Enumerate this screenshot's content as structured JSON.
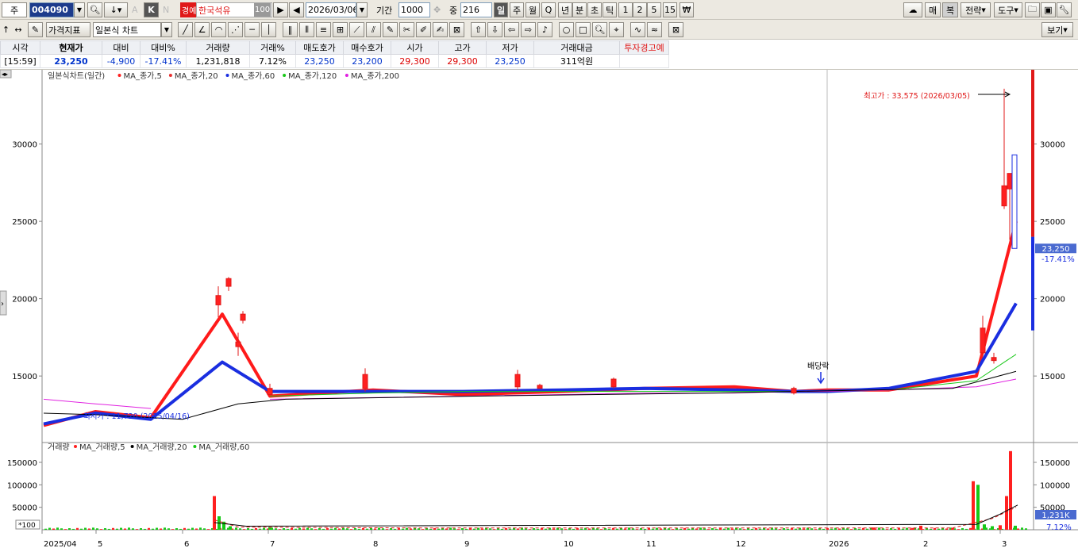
{
  "toolbar1": {
    "type_label": "주",
    "code": "004090",
    "badge": "경예",
    "name": "한국석유",
    "box_value": "100",
    "date": "2026/03/06",
    "period_label": "기간",
    "period_value": "1000",
    "count_label": "중",
    "count_value": "216",
    "intervals": [
      "일",
      "주",
      "월",
      "Q",
      "년",
      "분",
      "초",
      "틱",
      "1",
      "2",
      "5",
      "15",
      "₩"
    ],
    "right_buttons": [
      "매",
      "복",
      "전략",
      "도구"
    ]
  },
  "toolbar2": {
    "indicator_label": "가격지표",
    "chart_type": "일본식 차트",
    "view_label": "보기"
  },
  "quote": {
    "headers": [
      "시각",
      "현재가",
      "대비",
      "대비%",
      "거래량",
      "거래%",
      "매도호가",
      "매수호가",
      "시가",
      "고가",
      "저가",
      "거래대금",
      "투자경고예"
    ],
    "values": [
      "[15:59]",
      "23,250",
      "-4,900",
      "-17.41%",
      "1,231,818",
      "7.12%",
      "23,250",
      "23,200",
      "29,300",
      "29,300",
      "23,250",
      "311억원",
      ""
    ]
  },
  "price_legend": {
    "title": "일본식차트(일간)",
    "items": [
      {
        "label": "MA_종가,5",
        "color": "#ff2020"
      },
      {
        "label": "MA_종가,20",
        "color": "#e83030"
      },
      {
        "label": "MA_종가,60",
        "color": "#1a2ee0"
      },
      {
        "label": "MA_종가,120",
        "color": "#18c818"
      },
      {
        "label": "MA_종가,200",
        "color": "#e020e0"
      }
    ]
  },
  "volume_legend": {
    "title": "거래량",
    "items": [
      {
        "label": "MA_거래량,5",
        "color": "#ff2020"
      },
      {
        "label": "MA_거래량,20",
        "color": "#000000"
      },
      {
        "label": "MA_거래량,60",
        "color": "#18c818"
      }
    ]
  },
  "annotations": {
    "high": "최고가 : 33,575 (2026/03/05)",
    "low": "최저가 : 11,720 (2025/04/16)",
    "dividend": "배당락",
    "current_price": "23,250",
    "current_pct": "-17.41%",
    "current_volume": "1,231K",
    "volume_pct": "7.12%",
    "volume_unit": "*100"
  },
  "chart_data": {
    "type": "candlestick",
    "price_axis": {
      "ticks": [
        15000,
        20000,
        25000,
        30000
      ],
      "range": [
        10700,
        34800
      ]
    },
    "volume_axis": {
      "ticks": [
        50000,
        100000,
        150000
      ],
      "range": [
        0,
        180000
      ]
    },
    "x_labels": [
      "2025/04",
      "5",
      "6",
      "7",
      "8",
      "9",
      "10",
      "11",
      "12",
      "2026",
      "2",
      "3"
    ],
    "high": {
      "date": "2026/03/05",
      "value": 33575
    },
    "low": {
      "date": "2025/04/16",
      "value": 11720
    },
    "close": 23250,
    "series": [
      {
        "name": "MA_종가,5",
        "approx_values": [
          11800,
          12700,
          12300,
          19000,
          13700,
          14100,
          13800,
          14000,
          14200,
          14300,
          14000,
          14100,
          14100,
          15000,
          25000
        ]
      },
      {
        "name": "MA_종가,60",
        "approx_values": [
          11900,
          12600,
          12200,
          15900,
          14000,
          14000,
          14000,
          14100,
          14200,
          14100,
          14000,
          14000,
          14200,
          15300,
          19700
        ]
      },
      {
        "name": "MA_종가,120",
        "approx_values": [
          null,
          null,
          null,
          null,
          13700,
          13900,
          14000,
          14000,
          14000,
          14000,
          14000,
          14000,
          14100,
          14700,
          16400
        ]
      },
      {
        "name": "MA_종가,200",
        "approx_values": [
          13500,
          13200,
          12900,
          null,
          13500,
          13600,
          13700,
          13800,
          13900,
          13900,
          14000,
          14000,
          14100,
          14300,
          14800
        ]
      }
    ],
    "volume_peaks": [
      {
        "date": "2025/06",
        "value": 75000
      },
      {
        "date": "2026/03/03",
        "value": 108000
      },
      {
        "date": "2026/03/05",
        "value": 175000
      }
    ]
  }
}
